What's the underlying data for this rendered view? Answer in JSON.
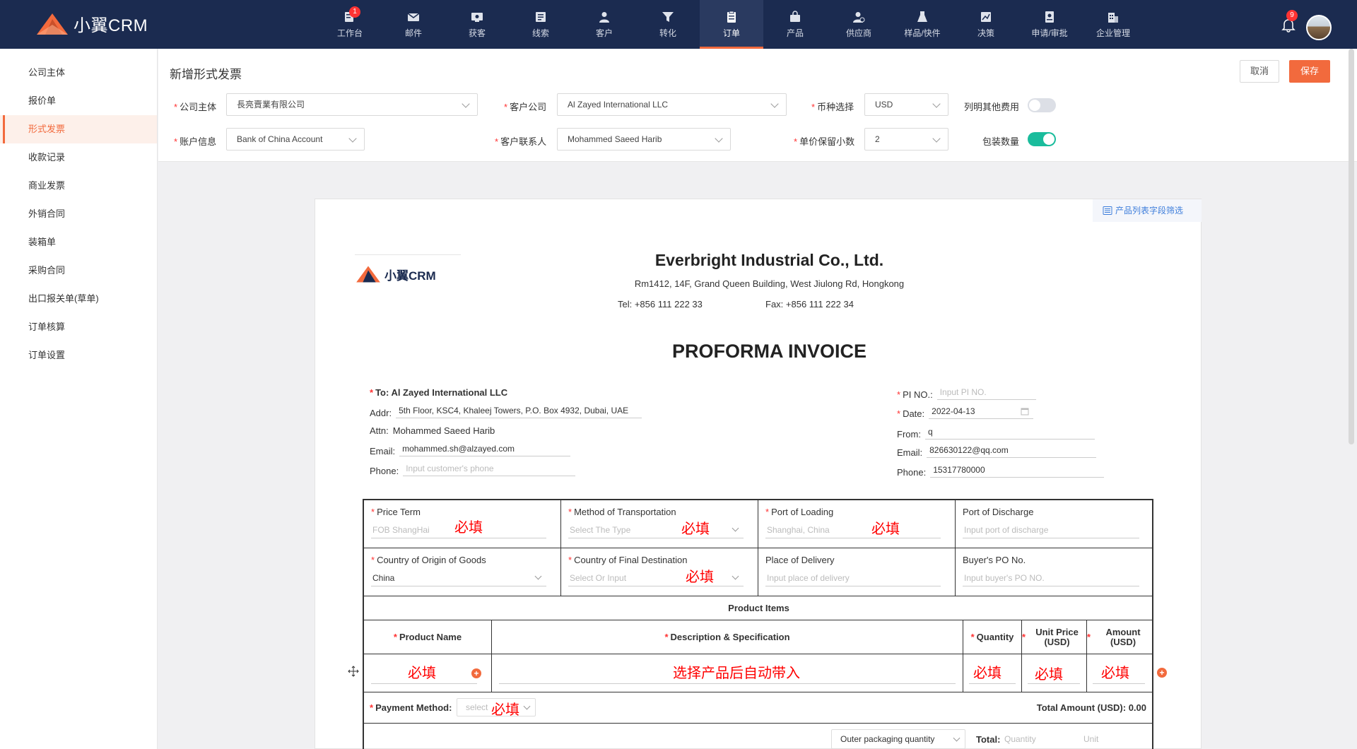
{
  "brand": {
    "name": "小翼CRM",
    "accent": "#f26a3d",
    "nav_bg": "#1b2b50"
  },
  "nav": {
    "items": [
      {
        "label": "工作台",
        "icon": "dashboard-icon",
        "badge": "1"
      },
      {
        "label": "邮件",
        "icon": "mail-icon"
      },
      {
        "label": "获客",
        "icon": "acquire-icon"
      },
      {
        "label": "线索",
        "icon": "leads-icon"
      },
      {
        "label": "客户",
        "icon": "customer-icon"
      },
      {
        "label": "转化",
        "icon": "funnel-icon"
      },
      {
        "label": "订单",
        "icon": "order-icon",
        "active": true
      },
      {
        "label": "产品",
        "icon": "product-icon"
      },
      {
        "label": "供应商",
        "icon": "supplier-icon"
      },
      {
        "label": "样品/快件",
        "icon": "sample-icon"
      },
      {
        "label": "决策",
        "icon": "decision-icon"
      },
      {
        "label": "申请/审批",
        "icon": "approval-icon"
      },
      {
        "label": "企业管理",
        "icon": "enterprise-icon"
      }
    ],
    "notifications": "9"
  },
  "sidebar": {
    "items": [
      "公司主体",
      "报价单",
      "形式发票",
      "收款记录",
      "商业发票",
      "外销合同",
      "装箱单",
      "采购合同",
      "出口报关单(草单)",
      "订单核算",
      "订单设置"
    ],
    "active_index": 2
  },
  "form": {
    "title": "新增形式发票",
    "cancel": "取消",
    "save": "保存",
    "company_label": "公司主体",
    "company_value": "長亮賣業有限公司",
    "customer_company_label": "客户公司",
    "customer_company_value": "Al Zayed International LLC",
    "currency_label": "币种选择",
    "currency_value": "USD",
    "other_fees_label": "列明其他费用",
    "account_label": "账户信息",
    "account_value": "Bank of China Account",
    "contact_label": "客户联系人",
    "contact_value": "Mohammed Saeed Harib",
    "decimals_label": "单价保留小数",
    "decimals_value": "2",
    "package_qty_label": "包装数量"
  },
  "invoice": {
    "filter_link": "产品列表字段筛选",
    "logo_text": "小翼CRM",
    "company_name": "Everbright Industrial Co., Ltd.",
    "company_address": "Rm1412, 14F, Grand Queen Building, West Jiulong Rd, Hongkong",
    "tel": "Tel: +856 111 222 33",
    "fax": "Fax: +856 111 222 34",
    "title": "PROFORMA INVOICE",
    "to": "To: Al Zayed International LLC",
    "addr_label": "Addr:",
    "addr_value": "5th Floor, KSC4, Khaleej Towers, P.O. Box 4932, Dubai, UAE",
    "attn_label": "Attn:",
    "attn_value": "Mohammed Saeed Harib",
    "email_label": "Email:",
    "email_value": "mohammed.sh@alzayed.com",
    "phone_label": "Phone:",
    "phone_placeholder": "Input customer's phone",
    "pi_label": "PI NO.:",
    "pi_placeholder": "Input PI NO.",
    "date_label": "Date:",
    "date_value": "2022-04-13",
    "from_label": "From:",
    "from_value": "q",
    "seller_email_label": "Email:",
    "seller_email_value": "826630122@qq.com",
    "seller_phone_label": "Phone:",
    "seller_phone_value": "15317780000"
  },
  "terms": {
    "price_term": "Price Term",
    "price_term_ph": "FOB ShangHai",
    "transport": "Method of Transportation",
    "transport_ph": "Select The Type",
    "port_loading": "Port of Loading",
    "port_loading_ph": "Shanghai, China",
    "port_discharge": "Port of Discharge",
    "port_discharge_ph": "Input port of discharge",
    "origin": "Country of Origin of Goods",
    "origin_value": "China",
    "destination": "Country of Final Destination",
    "destination_ph": "Select Or Input",
    "delivery": "Place of Delivery",
    "delivery_ph": "Input place of delivery",
    "buyer_po": "Buyer's PO No.",
    "buyer_po_ph": "Input buyer's PO NO.",
    "required_mark": "必填"
  },
  "products": {
    "section_title": "Product Items",
    "col_name": "Product Name",
    "col_desc": "Description & Specification",
    "col_qty": "Quantity",
    "col_unit_price": "Unit Price (USD)",
    "col_amount": "Amount (USD)",
    "auto_fill_note": "选择产品后自动带入"
  },
  "footer": {
    "payment_label": "Payment Method:",
    "payment_ph": "select",
    "total_amount": "Total Amount (USD): 0.00",
    "outer_packaging": "Outer packaging quantity",
    "total_label": "Total:",
    "quantity_ph": "Quantity",
    "unit_ph": "Unit"
  }
}
